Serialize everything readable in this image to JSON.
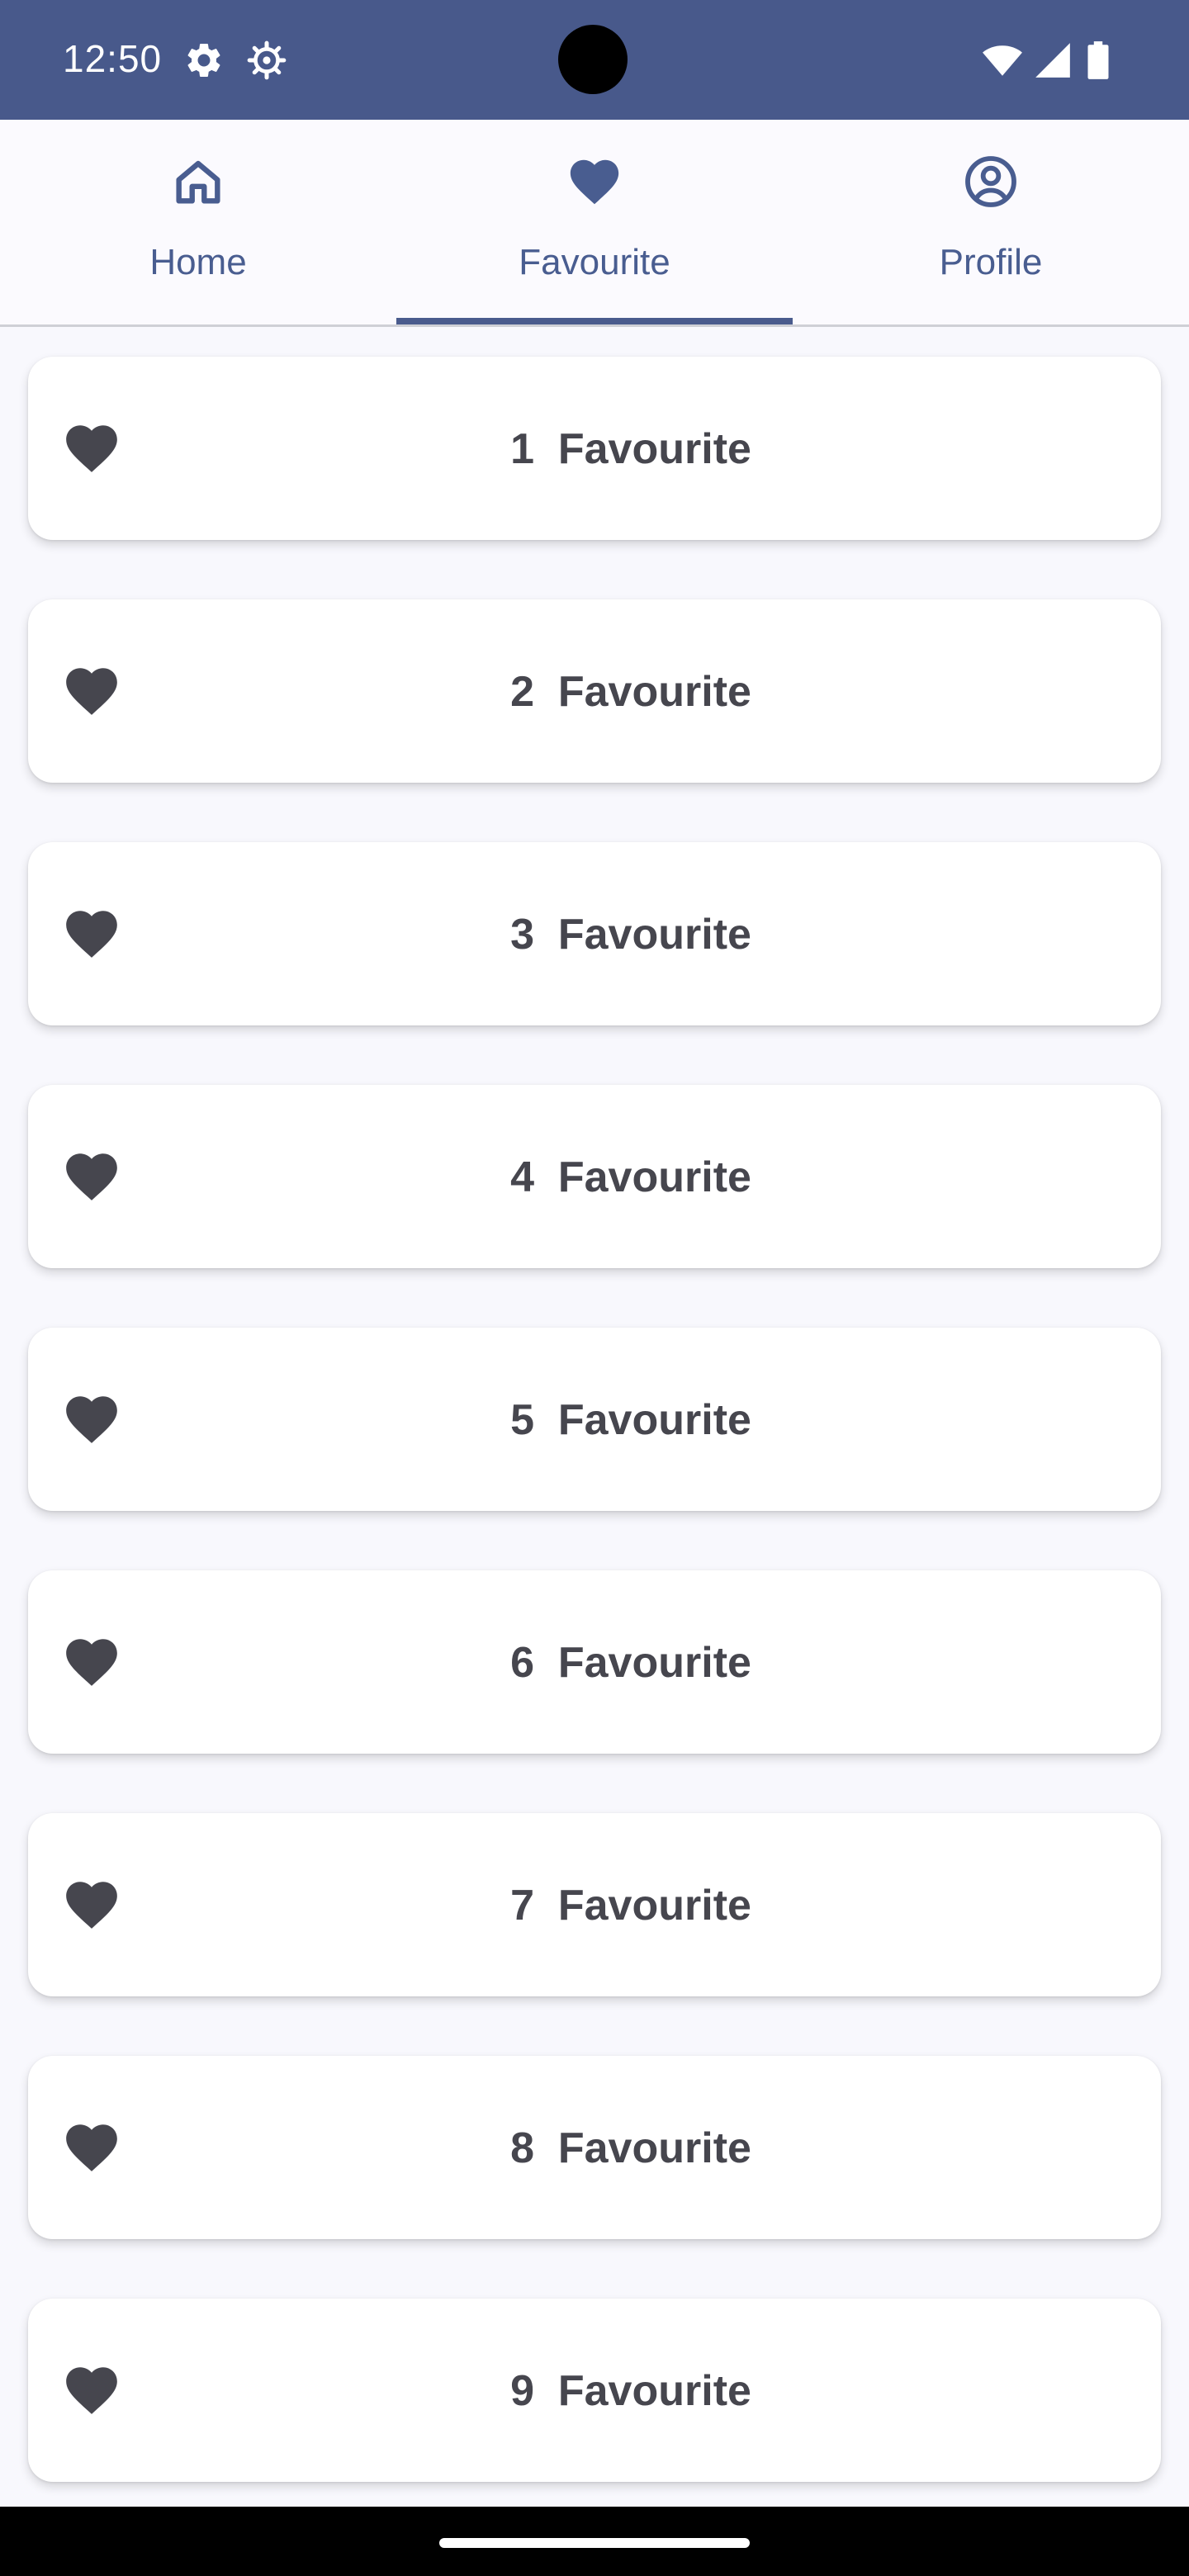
{
  "status_bar": {
    "time": "12:50",
    "left_icons": [
      "gear-icon",
      "settings-alt-icon"
    ],
    "right_icons": [
      "wifi-icon",
      "cellular-signal-icon",
      "battery-icon"
    ],
    "background": "#48598b"
  },
  "tabs": [
    {
      "label": "Home",
      "icon": "home-icon",
      "selected": false
    },
    {
      "label": "Favourite",
      "icon": "heart-icon",
      "selected": true
    },
    {
      "label": "Profile",
      "icon": "account-circle-icon",
      "selected": false
    }
  ],
  "favourites": [
    {
      "label": "1  Favourite",
      "icon": "heart-icon"
    },
    {
      "label": "2  Favourite",
      "icon": "heart-icon"
    },
    {
      "label": "3  Favourite",
      "icon": "heart-icon"
    },
    {
      "label": "4  Favourite",
      "icon": "heart-icon"
    },
    {
      "label": "5  Favourite",
      "icon": "heart-icon"
    },
    {
      "label": "6  Favourite",
      "icon": "heart-icon"
    },
    {
      "label": "7  Favourite",
      "icon": "heart-icon"
    },
    {
      "label": "8  Favourite",
      "icon": "heart-icon"
    },
    {
      "label": "9  Favourite",
      "icon": "heart-icon"
    }
  ],
  "colors": {
    "accent": "#4a5b8d",
    "card_text": "#46464e",
    "card_icon": "#46464e"
  }
}
